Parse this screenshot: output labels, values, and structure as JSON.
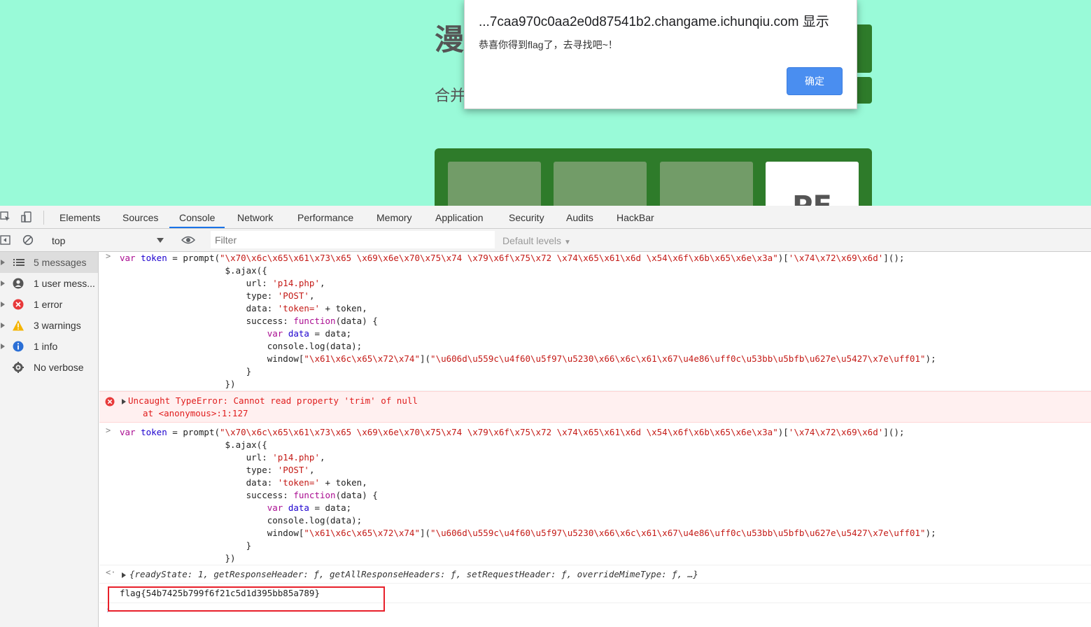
{
  "page": {
    "title_char": "漫",
    "subtitle_chars": "合并",
    "tile_text": "PF"
  },
  "alert": {
    "title": "...7caa970c0aa2e0d87541b2.changame.ichunqiu.com 显示",
    "message": "恭喜你得到flag了，去寻找吧~！",
    "ok_label": "确定"
  },
  "devtools": {
    "tabs": [
      "Elements",
      "Sources",
      "Console",
      "Network",
      "Performance",
      "Memory",
      "Application",
      "Security",
      "Audits",
      "HackBar"
    ],
    "active_tab": "Console",
    "context": "top",
    "filter_placeholder": "Filter",
    "levels_label": "Default levels",
    "sidebar": [
      {
        "label": "5 messages",
        "icon": "list-icon"
      },
      {
        "label": "1 user mess...",
        "icon": "user-icon"
      },
      {
        "label": "1 error",
        "icon": "error-icon"
      },
      {
        "label": "3 warnings",
        "icon": "warning-icon"
      },
      {
        "label": "1 info",
        "icon": "info-icon"
      },
      {
        "label": "No verbose",
        "icon": "gear-icon"
      }
    ]
  },
  "console": {
    "code_lines": [
      "var token = prompt(\"\\x70\\x6c\\x65\\x61\\x73\\x65 \\x69\\x6e\\x70\\x75\\x74 \\x79\\x6f\\x75\\x72 \\x74\\x65\\x61\\x6d \\x54\\x6f\\x6b\\x65\\x6e\\x3a\")['\\x74\\x72\\x69\\x6d']();",
      "                    $.ajax({",
      "                        url: 'p14.php',",
      "                        type: 'POST',",
      "                        data: 'token=' + token,",
      "                        success: function(data) {",
      "                            var data = data;",
      "                            console.log(data);",
      "                            window[\"\\x61\\x6c\\x65\\x72\\x74\"](\"\\u606d\\u559c\\u4f60\\u5f97\\u5230\\x66\\x6c\\x61\\x67\\u4e86\\uff0c\\u53bb\\u5bfb\\u627e\\u5427\\x7e\\uff01\");",
      "                        }",
      "                    })"
    ],
    "error_text": "Uncaught TypeError: Cannot read property 'trim' of null",
    "error_location": "at <anonymous>:1:127",
    "result_text": "{readyState: 1, getResponseHeader: ƒ, getAllResponseHeaders: ƒ, setRequestHeader: ƒ, overrideMimeType: ƒ, …}",
    "flag_output": "flag{54b7425b799f6f21c5d1d395bb85a789}"
  },
  "colors": {
    "page_bg": "#99fad8",
    "board_green": "#2e7b2a",
    "error_red": "#e01d1d",
    "highlight_box": "#e8202a",
    "alert_button": "#4a8ef0"
  }
}
